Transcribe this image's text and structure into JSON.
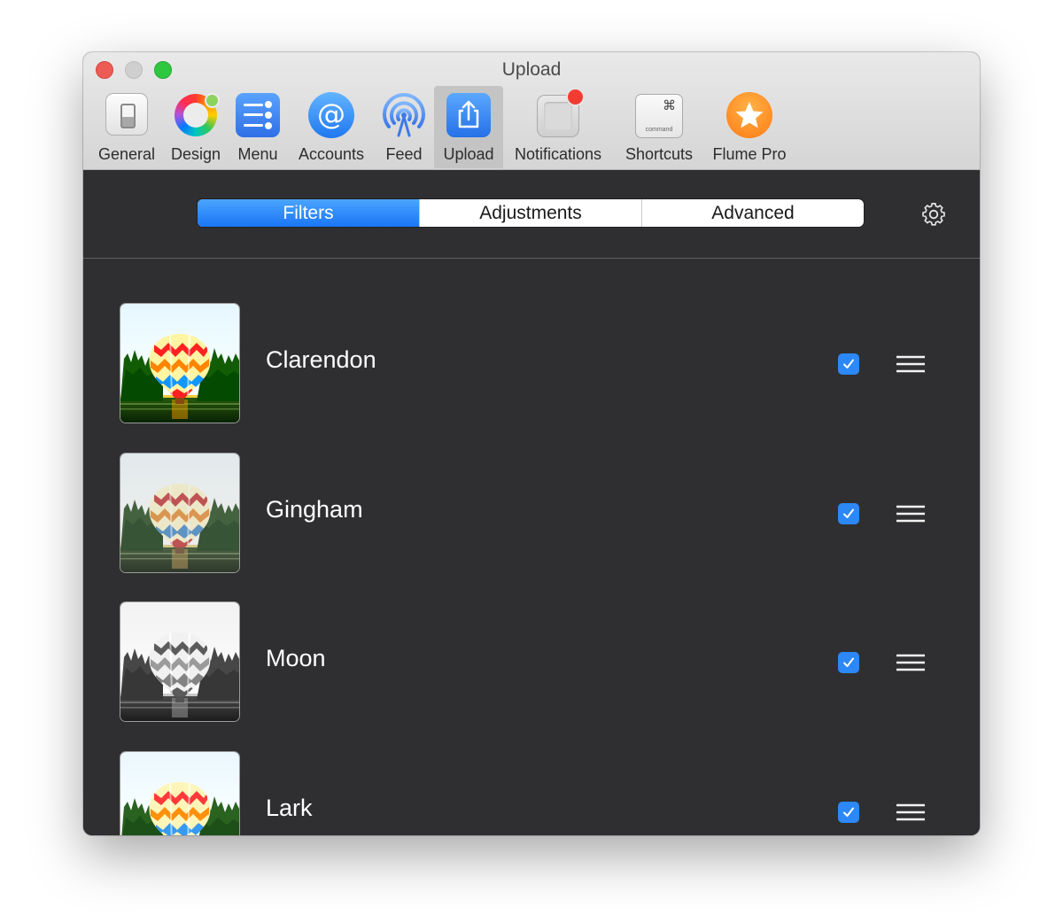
{
  "window": {
    "title": "Upload"
  },
  "toolbar": {
    "items": [
      {
        "label": "General",
        "icon": "general-icon"
      },
      {
        "label": "Design",
        "icon": "color-wheel-icon"
      },
      {
        "label": "Menu",
        "icon": "menu-icon"
      },
      {
        "label": "Accounts",
        "icon": "at-sign-icon"
      },
      {
        "label": "Feed",
        "icon": "feed-icon"
      },
      {
        "label": "Upload",
        "icon": "upload-icon",
        "selected": true
      },
      {
        "label": "Notifications",
        "icon": "notifications-icon"
      },
      {
        "label": "Shortcuts",
        "icon": "command-key-icon"
      },
      {
        "label": "Flume Pro",
        "icon": "star-icon"
      }
    ],
    "shortcuts_glyph": "⌘",
    "shortcuts_key_text": "command",
    "accounts_glyph": "@"
  },
  "segments": {
    "items": [
      "Filters",
      "Adjustments",
      "Advanced"
    ],
    "selected": "Filters"
  },
  "filters": [
    {
      "name": "Clarendon",
      "checked": true,
      "tone": "color"
    },
    {
      "name": "Gingham",
      "checked": true,
      "tone": "faded"
    },
    {
      "name": "Moon",
      "checked": true,
      "tone": "mono"
    },
    {
      "name": "Lark",
      "checked": true,
      "tone": "color"
    }
  ],
  "colors": {
    "accent": "#2b88f6",
    "content_background": "#2f2f32",
    "toolbar_background": "#dedede",
    "selected_toolbar_item": "#c4c4c4"
  }
}
